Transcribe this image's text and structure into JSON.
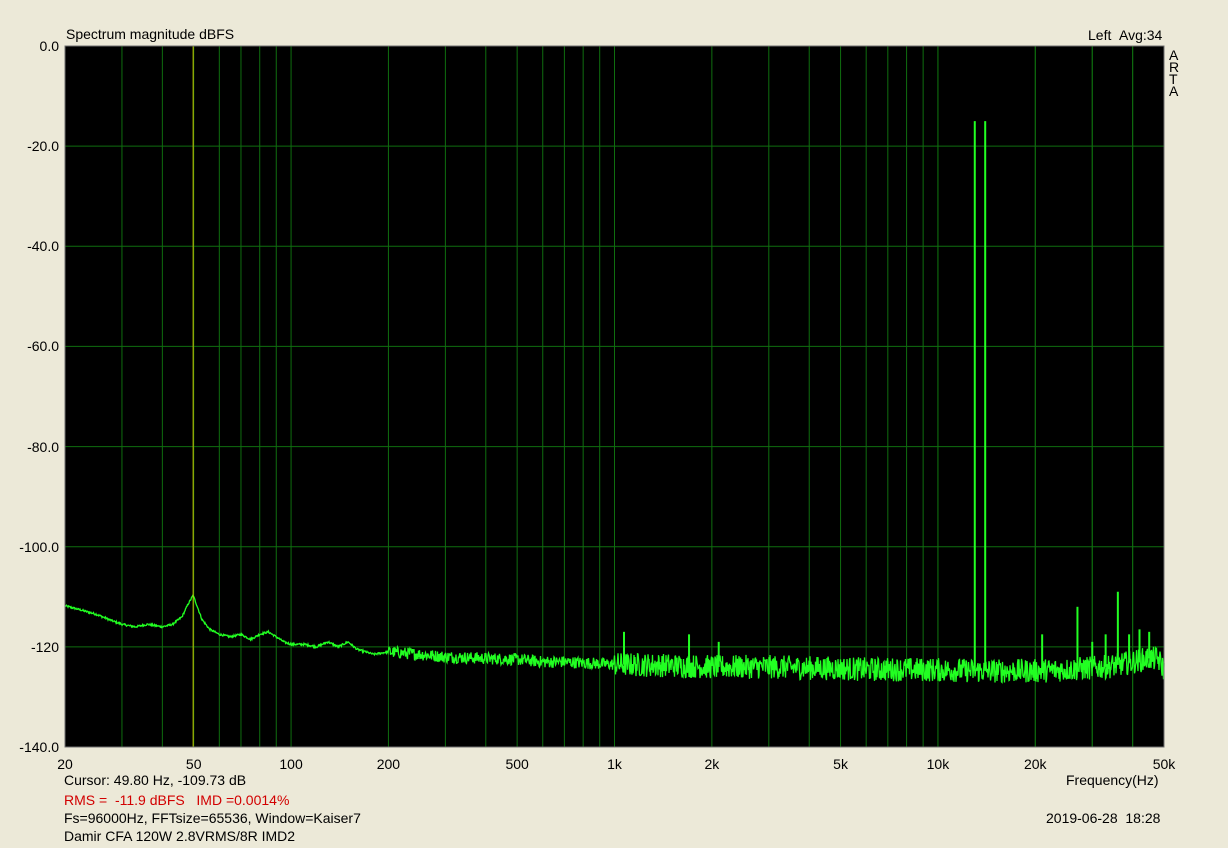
{
  "header": {
    "title": "Spectrum magnitude dBFS",
    "channel": "Left",
    "avg": "Avg:34",
    "brand_letters": [
      "A",
      "R",
      "T",
      "A"
    ]
  },
  "footer": {
    "cursor": "Cursor: 49.80 Hz, -109.73 dB",
    "rms": "RMS =  -11.9 dBFS   IMD =0.0014%",
    "params": "Fs=96000Hz, FFTsize=65536, Window=Kaiser7",
    "description": "Damir CFA 120W 2.8VRMS/8R IMD2",
    "timestamp": "2019-06-28  18:28"
  },
  "colors": {
    "plot_bg": "#000000",
    "grid": "#0f6e0f",
    "trace": "#22ff22",
    "cursor": "#c8c800",
    "rms_text": "#d20000",
    "window_bg": "#ece9d8"
  },
  "chart_data": {
    "type": "line",
    "title": "Spectrum magnitude dBFS",
    "xlabel": "Frequency(Hz)",
    "ylabel": "",
    "x_scale": "log",
    "xlim": [
      20,
      50000
    ],
    "ylim": [
      -140,
      0
    ],
    "grid": true,
    "x_tick_values": [
      20,
      50,
      100,
      200,
      500,
      1000,
      2000,
      5000,
      10000,
      20000,
      50000
    ],
    "x_tick_labels": [
      "20",
      "50",
      "100",
      "200",
      "500",
      "1k",
      "2k",
      "5k",
      "10k",
      "20k",
      "50k"
    ],
    "y_tick_values": [
      0,
      -20,
      -40,
      -60,
      -80,
      -100,
      -120,
      -140
    ],
    "y_tick_labels": [
      "0.0",
      "-20.0",
      "-40.0",
      "-60.0",
      "-80.0",
      "-100.0",
      "-120",
      "-140.0"
    ],
    "cursor": {
      "x": 49.8,
      "y": -109.73
    },
    "series": [
      {
        "x": [
          20,
          22,
          25,
          28,
          30,
          33,
          36,
          40,
          43,
          46,
          48,
          49.8,
          51,
          53,
          56,
          60,
          65,
          70,
          75,
          80,
          85,
          90,
          95,
          100,
          110,
          120,
          130,
          140,
          150,
          160,
          170,
          180,
          200,
          250,
          300,
          400,
          500,
          600,
          700,
          800,
          1000,
          1500,
          2000,
          3000,
          4000,
          5000,
          6000,
          7000,
          8000,
          10000,
          12000,
          13000,
          13500,
          14000,
          15000,
          17000,
          20000,
          22000,
          24000,
          27000,
          30000,
          33000,
          36000,
          40000,
          45000,
          48000,
          50000
        ],
        "values": [
          -111.8,
          -112.5,
          -113.5,
          -114.8,
          -115.5,
          -116,
          -115.5,
          -116,
          -115.5,
          -114,
          -111.5,
          -109.7,
          -111.5,
          -114.5,
          -116.5,
          -117.5,
          -118,
          -117.5,
          -118.5,
          -117.5,
          -117,
          -118,
          -119,
          -119.5,
          -119.5,
          -120,
          -119,
          -120,
          -119,
          -120.5,
          -121,
          -121.5,
          -121,
          -121.5,
          -122,
          -122.3,
          -122.5,
          -123,
          -123,
          -123.2,
          -123.5,
          -123.7,
          -124,
          -124,
          -124.2,
          -124.3,
          -124.5,
          -124.5,
          -124.5,
          -124.6,
          -124.7,
          -124.8,
          -124.8,
          -124.8,
          -124.8,
          -124.8,
          -124.8,
          -124.7,
          -124.6,
          -124.4,
          -124.2,
          -124,
          -123.6,
          -123,
          -122.3,
          -122.5,
          -124.5
        ]
      }
    ],
    "spikes": [
      {
        "x": 1070,
        "y": -117
      },
      {
        "x": 1700,
        "y": -117.5
      },
      {
        "x": 2100,
        "y": -119
      },
      {
        "x": 13000,
        "y": -15
      },
      {
        "x": 14000,
        "y": -15
      },
      {
        "x": 21000,
        "y": -117.5
      },
      {
        "x": 27000,
        "y": -112
      },
      {
        "x": 30000,
        "y": -119
      },
      {
        "x": 33000,
        "y": -117.5
      },
      {
        "x": 36000,
        "y": -109
      },
      {
        "x": 39000,
        "y": -117.5
      },
      {
        "x": 42000,
        "y": -116.5
      },
      {
        "x": 45000,
        "y": -117
      }
    ]
  }
}
